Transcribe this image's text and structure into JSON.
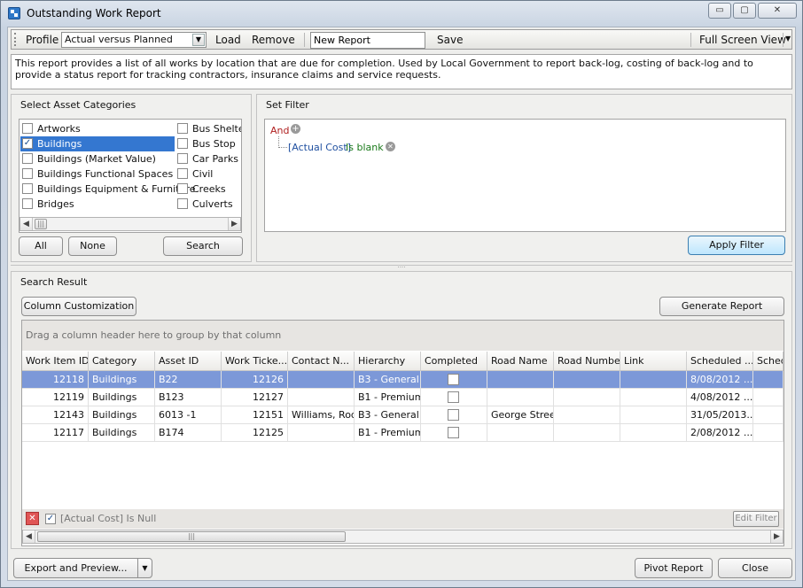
{
  "window": {
    "title": "Outstanding Work Report",
    "min_glyph": "▭",
    "max_glyph": "▢",
    "close_glyph": "✕"
  },
  "toolbar": {
    "profile_label": "Profile",
    "profile_value": "Actual versus Planned",
    "load": "Load",
    "remove": "Remove",
    "new_report_value": "New Report",
    "save": "Save",
    "full_screen": "Full Screen View"
  },
  "description": "This report provides a list of all works by location that are due for completion. Used by Local Government to report back-log, costing of back-log and to provide a status report for tracking contractors, insurance claims and service requests.",
  "asset_categories": {
    "title": "Select Asset Categories",
    "column1": [
      {
        "label": "Artworks",
        "checked": false
      },
      {
        "label": "Buildings",
        "checked": true
      },
      {
        "label": "Buildings (Market Value)",
        "checked": false
      },
      {
        "label": "Buildings Functional Spaces",
        "checked": false
      },
      {
        "label": "Buildings Equipment & Furniture",
        "checked": false
      },
      {
        "label": "Bridges",
        "checked": false
      }
    ],
    "column2": [
      {
        "label": "Bus Shelters",
        "checked": false
      },
      {
        "label": "Bus Stop",
        "checked": false
      },
      {
        "label": "Car Parks",
        "checked": false
      },
      {
        "label": "Civil",
        "checked": false
      },
      {
        "label": "Creeks",
        "checked": false
      },
      {
        "label": "Culverts",
        "checked": false
      }
    ],
    "all": "All",
    "none": "None",
    "search": "Search"
  },
  "set_filter": {
    "title": "Set Filter",
    "root_operator": "And",
    "condition_field": "[Actual Cost]",
    "condition_op": "Is blank",
    "apply": "Apply Filter"
  },
  "search_result": {
    "title": "Search Result",
    "column_customization": "Column Customization",
    "generate_report": "Generate Report",
    "group_hint": "Drag a column header here to group by that column",
    "columns": [
      "Work Item ID",
      "Category",
      "Asset ID",
      "Work Ticke...",
      "Contact N...",
      "Hierarchy",
      "Completed",
      "Road Name",
      "Road Number",
      "Link",
      "Scheduled ...",
      "Sched"
    ],
    "rows": [
      [
        "12118",
        "Buildings",
        "B22",
        "12126",
        "",
        "B3 - General",
        "",
        "",
        "",
        "",
        "8/08/2012 ...",
        ""
      ],
      [
        "12119",
        "Buildings",
        "B123",
        "12127",
        "",
        "B1 - Premium",
        "",
        "",
        "",
        "",
        "4/08/2012 ...",
        ""
      ],
      [
        "12143",
        "Buildings",
        "6013 -1",
        "12151",
        "Williams, Rod",
        "B3 - General",
        "",
        "George Street",
        "",
        "",
        "31/05/2013...",
        ""
      ],
      [
        "12117",
        "Buildings",
        "B174",
        "12125",
        "",
        "B1 - Premium",
        "",
        "",
        "",
        "",
        "2/08/2012 ...",
        ""
      ]
    ],
    "selected_row": 0,
    "filter_text": "[Actual Cost] Is Null",
    "edit_filter": "Edit Filter"
  },
  "footer": {
    "export": "Export and Preview...",
    "pivot": "Pivot Report",
    "close": "Close"
  }
}
